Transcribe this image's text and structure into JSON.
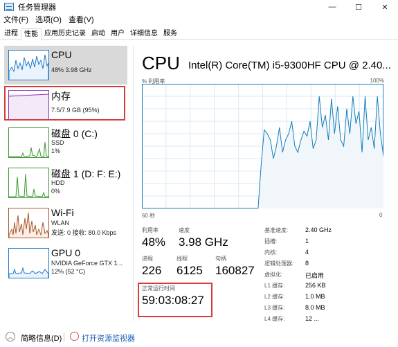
{
  "window": {
    "title": "任务管理器",
    "controls": [
      "—",
      "☐",
      "✕"
    ]
  },
  "menu": [
    "文件(F)",
    "选项(O)",
    "查看(V)"
  ],
  "tabs": [
    {
      "label": "进程",
      "active": false
    },
    {
      "label": "性能",
      "active": true
    },
    {
      "label": "应用历史记录",
      "active": false
    },
    {
      "label": "启动",
      "active": false
    },
    {
      "label": "用户",
      "active": false
    },
    {
      "label": "详细信息",
      "active": false
    },
    {
      "label": "服务",
      "active": false
    }
  ],
  "sidebar": [
    {
      "name": "CPU",
      "lines": [
        "48%  3.98 GHz"
      ],
      "color": "#1f77c9"
    },
    {
      "name": "内存",
      "lines": [
        "7.5/7.9 GB (95%)"
      ],
      "color": "#8b38b0"
    },
    {
      "name": "磁盘 0 (C:)",
      "lines": [
        "SSD",
        "1%"
      ],
      "color": "#3c9a2f"
    },
    {
      "name": "磁盘 1 (D: F: E:)",
      "lines": [
        "HDD",
        "0%"
      ],
      "color": "#3c9a2f"
    },
    {
      "name": "Wi-Fi",
      "lines": [
        "WLAN",
        "发送: 0 接收: 80.0 Kbps"
      ],
      "color": "#a8552a"
    },
    {
      "name": "GPU 0",
      "lines": [
        "NVIDIA GeForce GTX 1...",
        "12% (52 °C)"
      ],
      "color": "#1f77c9"
    }
  ],
  "main": {
    "title": "CPU",
    "model": "Intel(R) Core(TM) i5-9300HF CPU @ 2.40...",
    "graph_top_left": "% 利用率",
    "graph_top_right": "100%",
    "graph_bottom_left": "60 秒",
    "graph_bottom_right": "0",
    "utilization_label": "利用率",
    "utilization": "48%",
    "speed_label": "速度",
    "speed": "3.98 GHz",
    "processes_label": "进程",
    "processes": "226",
    "threads_label": "线程",
    "threads": "6125",
    "handles_label": "句柄",
    "handles": "160827",
    "uptime_label": "正常运行时间",
    "uptime": "59:03:08:27",
    "details": [
      {
        "key": "基准速度:",
        "value": "2.40 GHz"
      },
      {
        "key": "插槽:",
        "value": "1"
      },
      {
        "key": "内核:",
        "value": "4"
      },
      {
        "key": "逻辑处理器:",
        "value": "8"
      },
      {
        "key": "虚拟化:",
        "value": "已启用"
      },
      {
        "key": "L1 缓存:",
        "value": "256 KB"
      },
      {
        "key": "L2 缓存:",
        "value": "1.0 MB"
      },
      {
        "key": "L3 缓存:",
        "value": "8.0 MB"
      },
      {
        "key": "L4 缓存:",
        "value": "12 ..."
      }
    ]
  },
  "graph_values": [
    0,
    0,
    0,
    0,
    0,
    0,
    0,
    0,
    0,
    0,
    0,
    0,
    0,
    0,
    0,
    0,
    0,
    0,
    0,
    0,
    0,
    0,
    0,
    0,
    0,
    0,
    0,
    0,
    0,
    0,
    0,
    0,
    0,
    0,
    0,
    0,
    0,
    0,
    0,
    35,
    63,
    60,
    55,
    40,
    50,
    65,
    45,
    55,
    60,
    70,
    50,
    45,
    55,
    62,
    58,
    70,
    48,
    55,
    90,
    65,
    75,
    55,
    88,
    60,
    82,
    55,
    50,
    80,
    60,
    90,
    68,
    78,
    45,
    90,
    55,
    65,
    48,
    90,
    60,
    42
  ],
  "footer": {
    "fewer": "简略信息(D)",
    "resmon": "打开资源监视器"
  },
  "colors": {
    "cpu_line": "#117dbb",
    "cpu_fill": "#f1f6fa",
    "grid": "#d9eaf4",
    "highlight": "#d83b3b"
  }
}
